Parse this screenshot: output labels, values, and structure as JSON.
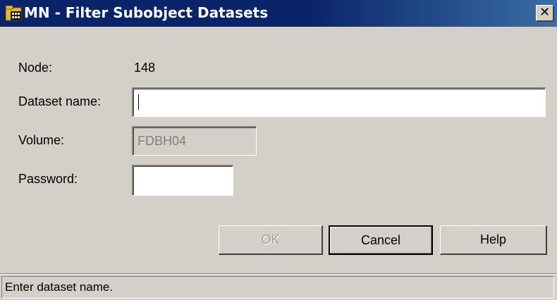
{
  "window": {
    "title": "MN - Filter Subobject Datasets",
    "close_symbol": "✕",
    "icon": "app-window-icon"
  },
  "form": {
    "node": {
      "label": "Node:",
      "value": "148"
    },
    "dataset_name": {
      "label": "Dataset name:",
      "value": ""
    },
    "volume": {
      "label": "Volume:",
      "value": "FDBH04",
      "enabled": false
    },
    "password": {
      "label": "Password:",
      "value": ""
    }
  },
  "buttons": {
    "ok": {
      "label": "OK",
      "enabled": false
    },
    "cancel": {
      "label": "Cancel",
      "default": true
    },
    "help": {
      "label": "Help"
    }
  },
  "status": {
    "text": "Enter dataset name."
  },
  "colors": {
    "titlebar": "#0a246a",
    "face": "#d4d0c8",
    "disabled_text": "#808080"
  }
}
